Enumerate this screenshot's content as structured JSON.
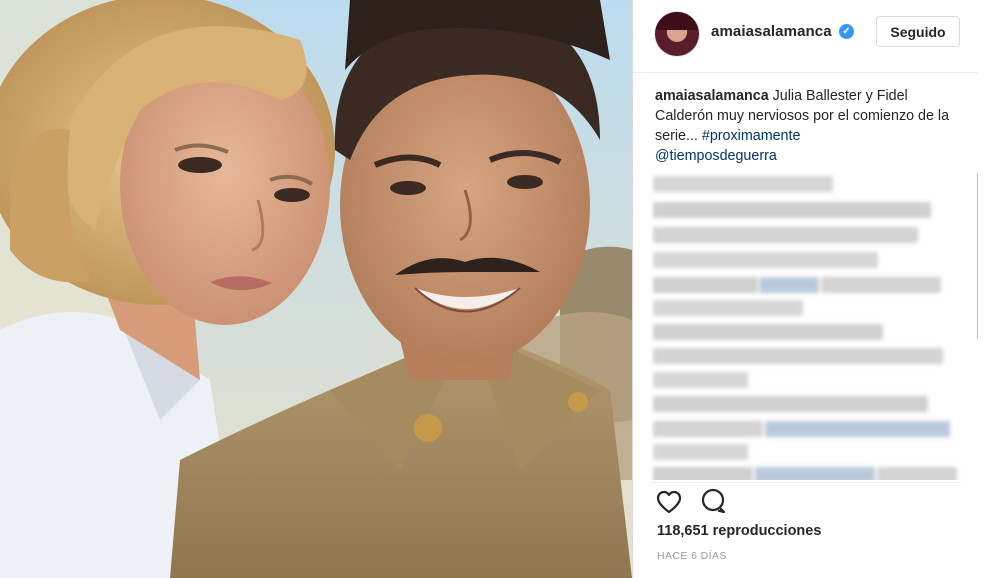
{
  "post": {
    "username": "amaiasalamanca",
    "follow_label": "Seguido",
    "caption_user": "amaiasalamanca",
    "caption_text": " Julia Ballester y Fidel Calderón muy nerviosos por el comienzo de la serie... ",
    "hashtag": "#proximamente",
    "mention": "@tiemposdeguerra",
    "views": "118,651 reproducciones",
    "time": "HACE 6 DÍAS"
  },
  "icons": {
    "verified": "verified-badge",
    "like": "heart-outline-icon",
    "comment": "speech-bubble-icon"
  },
  "colors": {
    "link": "#003569",
    "verified": "#3897f0",
    "text": "#262626",
    "muted": "#999999"
  }
}
